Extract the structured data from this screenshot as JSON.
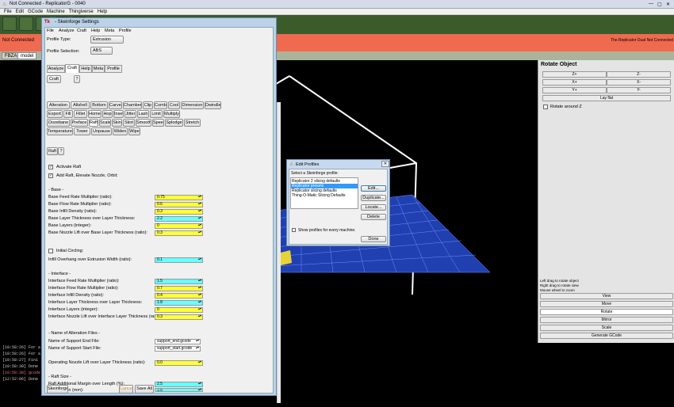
{
  "window": {
    "title": "Not Connected - ReplicatorG - 0040"
  },
  "menu": [
    "File",
    "Edit",
    "GCode",
    "Machine",
    "Thingiverse",
    "Help"
  ],
  "colors": {
    "accent": "#f06a4f",
    "toolbar": "#3c5b2b",
    "grid": "#1a3a9a",
    "cyan_field": "#66ffff",
    "yellow_field": "#ffff33"
  },
  "status": {
    "left": "Not Connected",
    "right": "The Replicator Dual Not Connected"
  },
  "tabs": [
    "FBZA",
    "model"
  ],
  "right_panel": {
    "title": "Rotate Object",
    "buttons": [
      "Z+",
      "Z-",
      "X+",
      "X-",
      "Y+",
      "Y-"
    ],
    "lay_flat": "Lay flat",
    "rotate_around": "Rotate around Z",
    "hints": [
      "Left drag to rotate object",
      "Right drag to rotate view",
      "Mouse wheel to zoom"
    ],
    "modes": [
      "View",
      "Move",
      "Rotate",
      "Mirror",
      "Scale"
    ],
    "generate": "Generate GCode"
  },
  "console": [
    "[10:58:26] For a",
    "[10:58:26] For a",
    "[10:58:27] Fini",
    "[10:58:30] Done",
    "[10:58:30] gcode",
    "[12:52:06] Done"
  ],
  "skeinforge": {
    "title": "- Skeinforge Settings",
    "menu": [
      "File",
      "Analyze",
      "Craft",
      "Help",
      "Meta",
      "Profile"
    ],
    "profile_type_label": "Profile Type:",
    "profile_type": "Extrusion",
    "profile_selection_label": "Profile Selection:",
    "profile_selection": "ABS",
    "tabs": [
      "Analyze",
      "Craft",
      "Help",
      "Meta",
      "Profile"
    ],
    "sub": {
      "craft": "Craft",
      "q": "?"
    },
    "plugins": [
      [
        "Alteration",
        "Altshell",
        "Bottom",
        "Carve",
        "Chamber",
        "Clip",
        "Comb",
        "Cool",
        "Dimension",
        "Dwindle"
      ],
      [
        "Export",
        "Fill",
        "Fillet",
        "Home",
        "Hop",
        "Inset",
        "Jitter",
        "Lash",
        "Limit",
        "Multiply"
      ],
      [
        "Oozebane",
        "Preface",
        "Raft",
        "Scale",
        "Skin",
        "Skirt",
        "Smooth",
        "Speed",
        "Splodge",
        "Stretch"
      ],
      [
        "Temperature",
        "Tower",
        "Unpause",
        "Widen",
        "Wipe"
      ]
    ],
    "raft_tab": {
      "name": "Raft",
      "q": "?"
    },
    "activate_raft": "Activate Raft",
    "add_raft": "Add Raft, Elevate Nozzle, Orbit:",
    "base_header": "- Base -",
    "base": [
      {
        "label": "Base Feed Rate Multiplier (ratio):",
        "value": "0.75",
        "color": "y"
      },
      {
        "label": "Base Flow Rate Multiplier (ratio):",
        "value": "0.6",
        "color": "y"
      },
      {
        "label": "Base Infill Density (ratio):",
        "value": "0.3",
        "color": "y"
      },
      {
        "label": "Base Layer Thickness over Layer Thickness:",
        "value": "2.2",
        "color": "c"
      },
      {
        "label": "Base Layers (integer):",
        "value": "0",
        "color": "y"
      },
      {
        "label": "Base Nozzle Lift over Base Layer Thickness (ratio):",
        "value": "0.3",
        "color": "y"
      }
    ],
    "initial_circling": "Initial Circling:",
    "infill_overhang": {
      "label": "Infill Overhang over Extrusion Width (ratio):",
      "value": "0.1"
    },
    "interface_header": "- Interface -",
    "interface": [
      {
        "label": "Interface Feed Rate Multiplier (ratio):",
        "value": "1.5",
        "color": "c"
      },
      {
        "label": "Interface Flow Rate Multiplier (ratio):",
        "value": "0.7",
        "color": "y"
      },
      {
        "label": "Interface Infill Density (ratio):",
        "value": "0.4",
        "color": "y"
      },
      {
        "label": "Interface Layer Thickness over Layer Thickness:",
        "value": "1.8",
        "color": "c"
      },
      {
        "label": "Interface Layers (integer):",
        "value": "0",
        "color": "y"
      },
      {
        "label": "Interface Nozzle Lift over Interface Layer Thickness (ratio):",
        "value": "0.3",
        "color": "y"
      }
    ],
    "alteration_header": "- Name of Alteration Files -",
    "alteration": [
      {
        "label": "Name of Support End File:",
        "value": "support_end.gcode"
      },
      {
        "label": "Name of Support Start File:",
        "value": "support_start.gcode"
      }
    ],
    "operating": {
      "label": "Operating Nozzle Lift over Layer Thickness (ratio):",
      "value": "0.0"
    },
    "raft_size_header": "- Raft Size -",
    "raft_size": [
      {
        "label": "Raft Additional Margin over Length (%):",
        "value": "2.5"
      },
      {
        "label": "Raft Margin (mm):",
        "value": "1.5"
      }
    ],
    "footer": {
      "skeinforge": "Skeinforge",
      "cancel": "Cancel",
      "save_all": "Save All"
    }
  },
  "edit_profiles": {
    "title": "Edit Profiles",
    "prompt": "Select a Skeinforge profile:",
    "items": [
      "Replicator 2 slicing defaults",
      "Replicator presets",
      "Replicator slicing defaults",
      "Thing-O-Matic Slicing Defaults"
    ],
    "buttons": [
      "Edit...",
      "Duplicate...",
      "Locate...",
      "Delete"
    ],
    "show_all": "Show profiles for every machine.",
    "done": "Done"
  }
}
